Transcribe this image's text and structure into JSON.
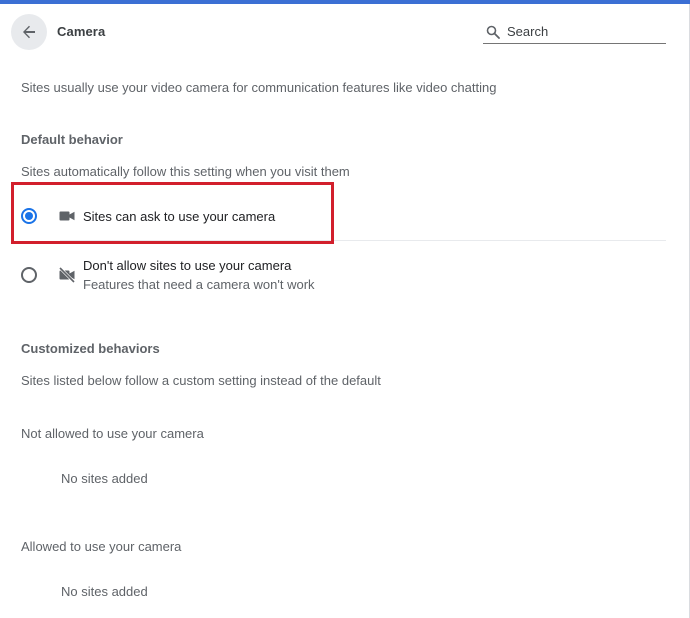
{
  "header": {
    "title": "Camera",
    "search_placeholder": "Search",
    "back_icon": "arrow-back-icon",
    "search_icon": "search-icon"
  },
  "description": "Sites usually use your video camera for communication features like video chatting",
  "default_behavior": {
    "heading": "Default behavior",
    "subtext": "Sites automatically follow this setting when you visit them",
    "options": [
      {
        "label": "Sites can ask to use your camera",
        "sublabel": "",
        "icon": "videocam-icon",
        "selected": true
      },
      {
        "label": "Don't allow sites to use your camera",
        "sublabel": "Features that need a camera won't work",
        "icon": "videocam-off-icon",
        "selected": false
      }
    ]
  },
  "customized": {
    "heading": "Customized behaviors",
    "subtext": "Sites listed below follow a custom setting instead of the default",
    "not_allowed": {
      "label": "Not allowed to use your camera",
      "empty": "No sites added"
    },
    "allowed": {
      "label": "Allowed to use your camera",
      "empty": "No sites added"
    }
  },
  "colors": {
    "accent": "#1a73e8",
    "top_bar": "#3b6fd4",
    "highlight": "#d21f2c"
  }
}
